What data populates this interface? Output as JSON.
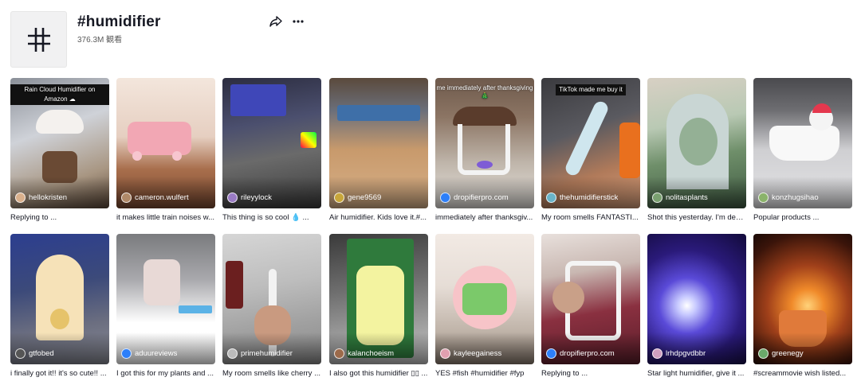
{
  "header": {
    "title": "#humidifier",
    "views": "376.3M 観看",
    "share_icon": "share-icon",
    "more_icon": "more-icon"
  },
  "videos": [
    {
      "author": "hellokristen",
      "caption": "Replying to ...",
      "overlay": "Rain Cloud Humidifier on Amazon ☁"
    },
    {
      "author": "cameron.wulfert",
      "caption": "it makes little train noises w...",
      "overlay": ""
    },
    {
      "author": "rileyylock",
      "caption": "This thing is so cool 💧 ...",
      "overlay": ""
    },
    {
      "author": "gene9569",
      "caption": "Air humidifier. Kids love it.#...",
      "overlay": ""
    },
    {
      "author": "dropifierpro.com",
      "caption": "immediately after thanksgiv...",
      "overlay": "me immediately after thanksgiving 🎄"
    },
    {
      "author": "thehumidifierstick",
      "caption": "My room smells FANTASTI...",
      "overlay": "TikTok made me buy it"
    },
    {
      "author": "nolitasplants",
      "caption": "Shot this yesterday. I'm dea...",
      "overlay": ""
    },
    {
      "author": "konzhugsihao",
      "caption": "Popular products ...",
      "overlay": ""
    },
    {
      "author": "gtfobed",
      "caption": "i finally got it!! it's so cute!! ...",
      "overlay": ""
    },
    {
      "author": "aduureviews",
      "caption": "I got this for my plants and ...",
      "overlay": ""
    },
    {
      "author": "primehumidifier",
      "caption": "My room smells like cherry ...",
      "overlay": ""
    },
    {
      "author": "kalanchoeism",
      "caption": "I also got this humidifier ▯▯ ...",
      "overlay": ""
    },
    {
      "author": "kayleegainess",
      "caption": "YES #fish #humidifier #fyp",
      "overlay": ""
    },
    {
      "author": "dropifierpro.com",
      "caption": "Replying to ...",
      "overlay": ""
    },
    {
      "author": "lrhdpgvdbbr",
      "caption": "Star light humidifier, give it ...",
      "overlay": ""
    },
    {
      "author": "greenegy",
      "caption": "#screammovie wish listed...",
      "overlay": ""
    }
  ]
}
